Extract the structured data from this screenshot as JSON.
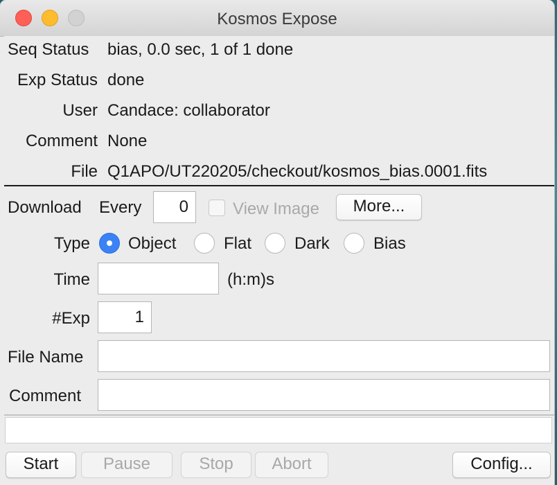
{
  "window": {
    "title": "Kosmos Expose"
  },
  "status": {
    "seq_label": "Seq Status",
    "seq_value": "bias, 0.0 sec, 1 of 1 done",
    "exp_label": "Exp Status",
    "exp_value": "done",
    "user_label": "User",
    "user_value": "Candace: collaborator",
    "comment_label": "Comment",
    "comment_value": "None",
    "file_label": "File",
    "file_value": "Q1APO/UT220205/checkout/kosmos_bias.0001.fits"
  },
  "download": {
    "label": "Download",
    "every_label": "Every",
    "every_value": "0",
    "view_image_label": "View Image",
    "more_label": "More..."
  },
  "type": {
    "label": "Type",
    "options": [
      "Object",
      "Flat",
      "Dark",
      "Bias"
    ],
    "selected": "Object"
  },
  "time": {
    "label": "Time",
    "value": "",
    "units": "(h:m)s"
  },
  "numexp": {
    "label": "#Exp",
    "value": "1"
  },
  "file_name": {
    "label": "File Name",
    "value": ""
  },
  "comment": {
    "label": "Comment",
    "value": ""
  },
  "message": {
    "value": ""
  },
  "buttons": {
    "start": "Start",
    "pause": "Pause",
    "stop": "Stop",
    "abort": "Abort",
    "config": "Config..."
  },
  "colors": {
    "accent": "#3b82f6",
    "close": "#fe5f57",
    "minimize": "#febc2e"
  }
}
